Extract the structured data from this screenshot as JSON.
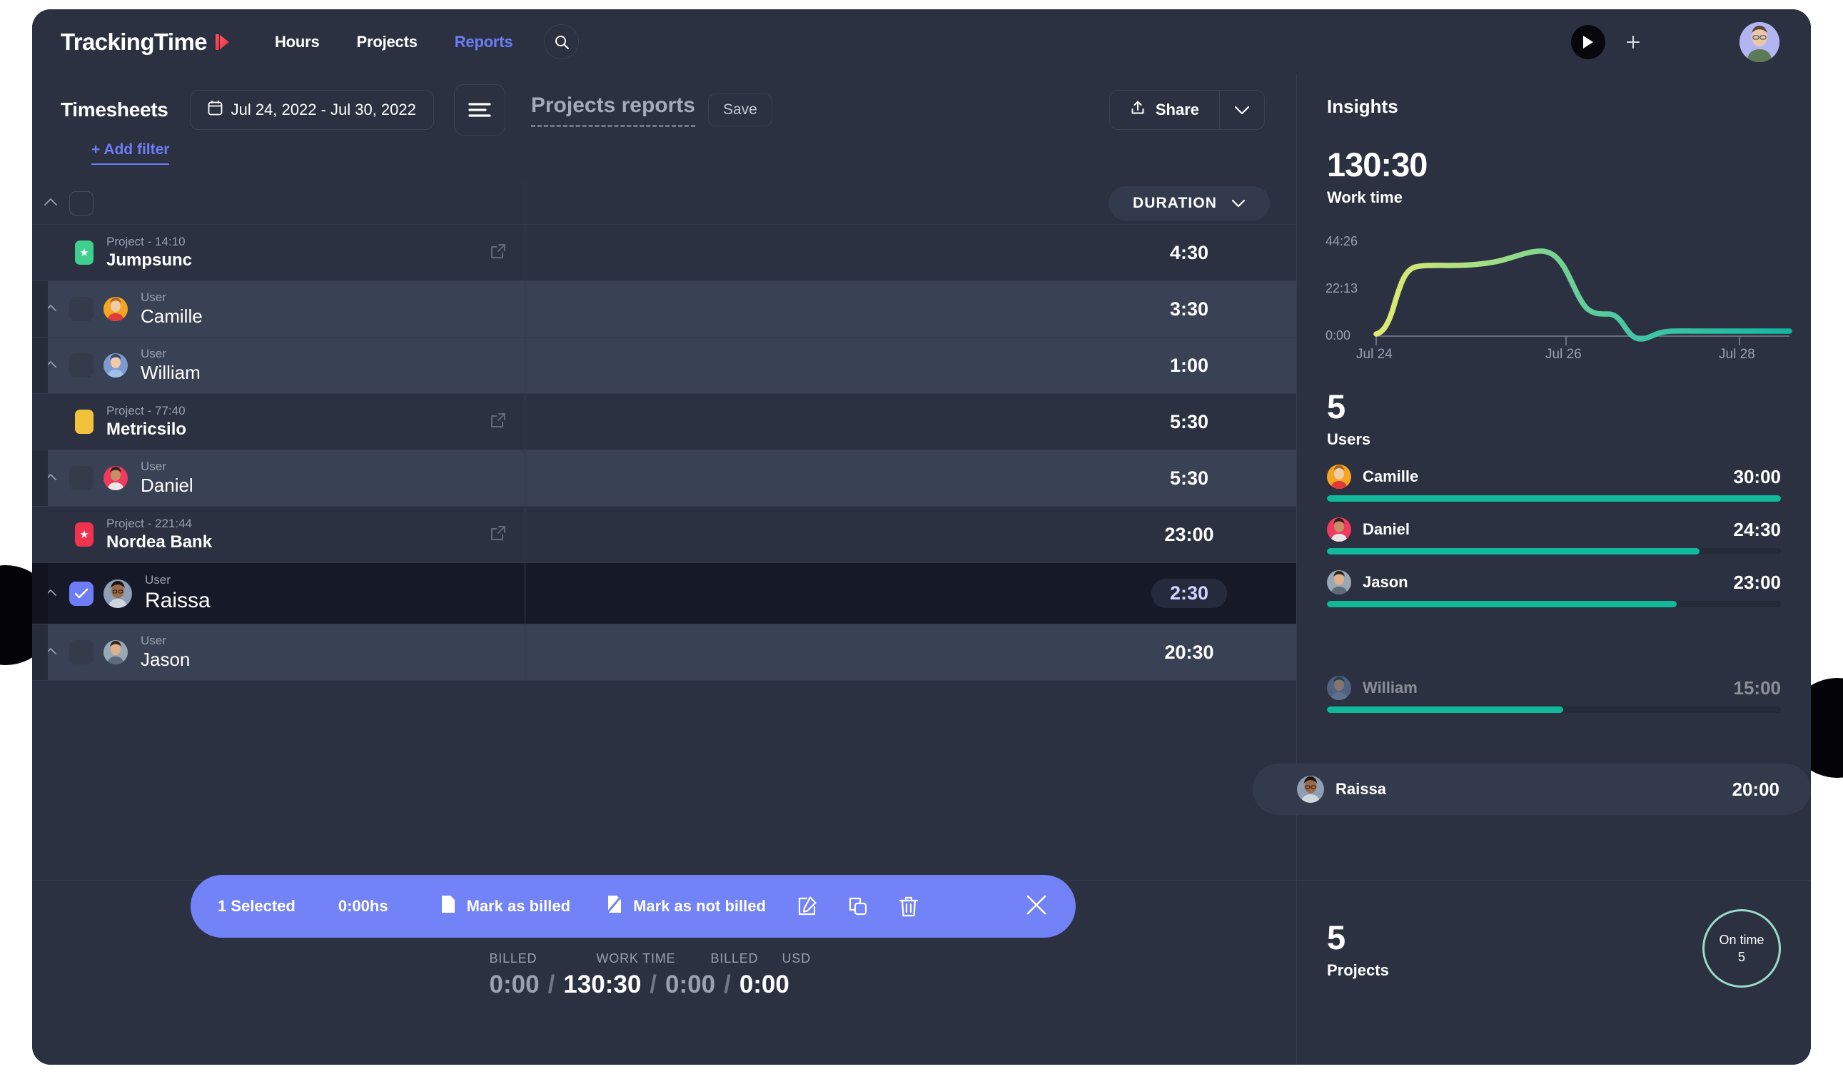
{
  "brand": {
    "logo_text": "TrackingTime",
    "logo_icon": "play-triangle-logo",
    "accent": "#6d7cf7",
    "green": "#10b99a",
    "red": "#f0324f"
  },
  "topnav": {
    "links": [
      {
        "label": "Hours",
        "active": false
      },
      {
        "label": "Projects",
        "active": false
      },
      {
        "label": "Reports",
        "active": true
      }
    ],
    "search_icon": "search-icon",
    "play_icon": "play-icon",
    "plus_icon": "plus-icon",
    "avatar": "user-avatar"
  },
  "subheader": {
    "page_title": "Timesheets",
    "date_range": "Jul 24, 2022 - Jul 30, 2022",
    "calendar_icon": "calendar-icon",
    "filter_icon": "filter-lines-icon",
    "report_title": "Projects reports",
    "save_label": "Save",
    "share_label": "Share",
    "share_icon": "upload-icon",
    "share_caret_icon": "chevron-down-icon",
    "add_filter": "+ Add filter"
  },
  "table": {
    "duration_header": "DURATION",
    "duration_caret_icon": "chevron-down-icon",
    "rows": [
      {
        "type": "project",
        "sub": "Project - 14:10",
        "name": "Jumpsunc",
        "duration": "4:30",
        "swatch": "#3ecf8e",
        "swatch_icon": "star",
        "selected": false
      },
      {
        "type": "user",
        "sub": "User",
        "name": "Camille",
        "duration": "3:30",
        "avatar": "camille",
        "selected": false
      },
      {
        "type": "user",
        "sub": "User",
        "name": "William",
        "duration": "1:00",
        "avatar": "william",
        "selected": false
      },
      {
        "type": "project",
        "sub": "Project - 77:40",
        "name": "Metricsilo",
        "duration": "5:30",
        "swatch": "#f2c23c",
        "swatch_icon": "",
        "selected": false
      },
      {
        "type": "user",
        "sub": "User",
        "name": "Daniel",
        "duration": "5:30",
        "avatar": "daniel",
        "selected": false
      },
      {
        "type": "project",
        "sub": "Project - 221:44",
        "name": "Nordea Bank",
        "duration": "23:00",
        "swatch": "#f0324f",
        "swatch_icon": "star",
        "selected": false
      },
      {
        "type": "user",
        "sub": "User",
        "name": "Raissa",
        "duration": "2:30",
        "avatar": "raissa",
        "selected": true
      },
      {
        "type": "user",
        "sub": "User",
        "name": "Jason",
        "duration": "20:30",
        "avatar": "jason",
        "selected": false
      }
    ]
  },
  "selection_toolbar": {
    "count_label": "1 Selected",
    "hours_label": "0:00hs",
    "mark_billed": "Mark as billed",
    "mark_not_billed": "Mark as not billed",
    "billed_icon": "document-dollar-icon",
    "not_billed_icon": "document-slash-icon",
    "edit_icon": "edit-pencil-icon",
    "copy_icon": "copy-icon",
    "delete_icon": "trash-icon",
    "close_icon": "close-icon"
  },
  "totals": {
    "labels": [
      "BILLED",
      "WORK TIME",
      "BILLED",
      "USD"
    ],
    "values": [
      "0:00",
      "130:30",
      "0:00",
      "0:00"
    ],
    "separator": "/"
  },
  "insights": {
    "title": "Insights",
    "work_time": {
      "value": "130:30",
      "label": "Work time"
    },
    "users": {
      "count": "5",
      "label": "Users"
    },
    "projects": {
      "count": "5",
      "label": "Projects"
    },
    "on_time": {
      "label": "On time",
      "value": "5"
    },
    "user_list": [
      {
        "name": "Camille",
        "time": "30:00",
        "pct": 100,
        "avatar": "camille",
        "highlight": false
      },
      {
        "name": "Daniel",
        "time": "24:30",
        "pct": 82,
        "avatar": "daniel",
        "highlight": false
      },
      {
        "name": "Jason",
        "time": "23:00",
        "pct": 77,
        "avatar": "jason",
        "highlight": false
      },
      {
        "name": "Raissa",
        "time": "20:00",
        "pct": 67,
        "avatar": "raissa",
        "highlight": true
      },
      {
        "name": "William",
        "time": "15:00",
        "pct": 52,
        "avatar": "william",
        "highlight": false
      }
    ]
  },
  "chart_data": {
    "type": "area",
    "title": "Work time",
    "xlabel": "",
    "ylabel": "",
    "x": [
      "Jul 24",
      "Jul 25",
      "Jul 26",
      "Jul 27",
      "Jul 28",
      "Jul 29",
      "Jul 30"
    ],
    "tick_labels_x": [
      "Jul 24",
      "Jul 26",
      "Jul 28"
    ],
    "tick_labels_y": [
      "0:00",
      "22:13",
      "44:26"
    ],
    "ylim": [
      0,
      44.43
    ],
    "grid": false,
    "legend": "none",
    "series": [
      {
        "name": "Work time",
        "values": [
          0,
          33.0,
          33.5,
          36.5,
          30.0,
          10.5,
          0.8
        ],
        "color_start": "#e3ea72",
        "color_end": "#14b79f"
      }
    ]
  }
}
